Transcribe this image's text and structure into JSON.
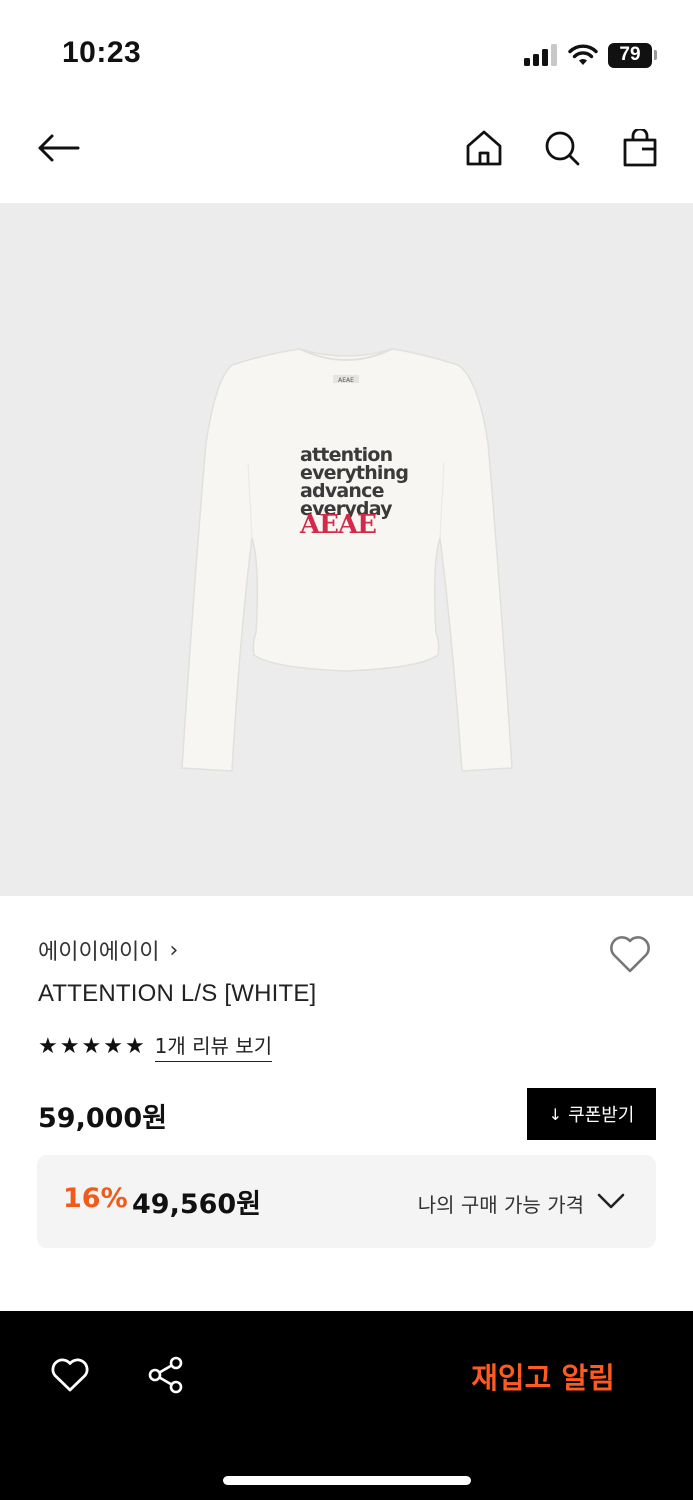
{
  "status_bar": {
    "time": "10:23",
    "battery": "79"
  },
  "nav": {
    "back_icon": "arrow-left-icon",
    "home_icon": "home-icon",
    "search_icon": "search-icon",
    "bag_icon": "shopping-bag-icon"
  },
  "product_image": {
    "print_lines": [
      "attention",
      "everything",
      "advance",
      "everyday"
    ],
    "print_logo": "AEAE",
    "neck_label": "AEAE",
    "background_color": "#ececec",
    "shirt_color": "#f7f6f3",
    "logo_color": "#d42a4a"
  },
  "product": {
    "brand": "에이이에이이",
    "brand_chevron": "›",
    "name": "ATTENTION L/S [WHITE]",
    "stars": [
      "★",
      "★",
      "★",
      "★",
      "★"
    ],
    "review_link": "1개 리뷰 보기",
    "price": "59,000원",
    "coupon_button": "쿠폰받기",
    "coupon_icon": "↓",
    "discount_rate": "16%",
    "discount_price": "49,560원",
    "my_price_label": "나의 구매 가능 가격"
  },
  "bottom_bar": {
    "like_icon": "heart-icon",
    "share_icon": "share-icon",
    "restock_button": "재입고 알림"
  },
  "colors": {
    "accent": "#ff5a1f",
    "discount": "#f05a1a",
    "black": "#000000"
  }
}
